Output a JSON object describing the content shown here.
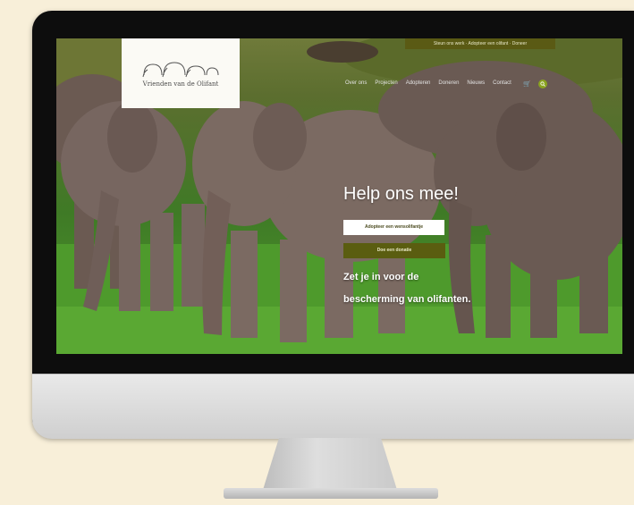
{
  "site": {
    "top_bar_text": "Steun ons werk · Adopteer een olifant · Doneer",
    "logo_text": "Vrienden van de Olifant",
    "nav_items": [
      "Over ons",
      "Projecten",
      "Adopteren",
      "Doneren",
      "Nieuws",
      "Contact"
    ],
    "hero_title": "Help ons mee!",
    "adopt_button": "Adopteer een wensolifantje",
    "donate_button": "Doe een donatie",
    "tagline_line1": "Zet je in voor de",
    "tagline_line2": "bescherming van olifanten."
  },
  "icons": {
    "cart": "cart-icon",
    "search": "search-icon",
    "logo_mark": "elephants-logo-icon"
  },
  "colors": {
    "page_background": "#f8efd9",
    "top_bar": "#5a5a14",
    "donate_button": "#5a5d10",
    "search_button": "#8aa31f"
  }
}
